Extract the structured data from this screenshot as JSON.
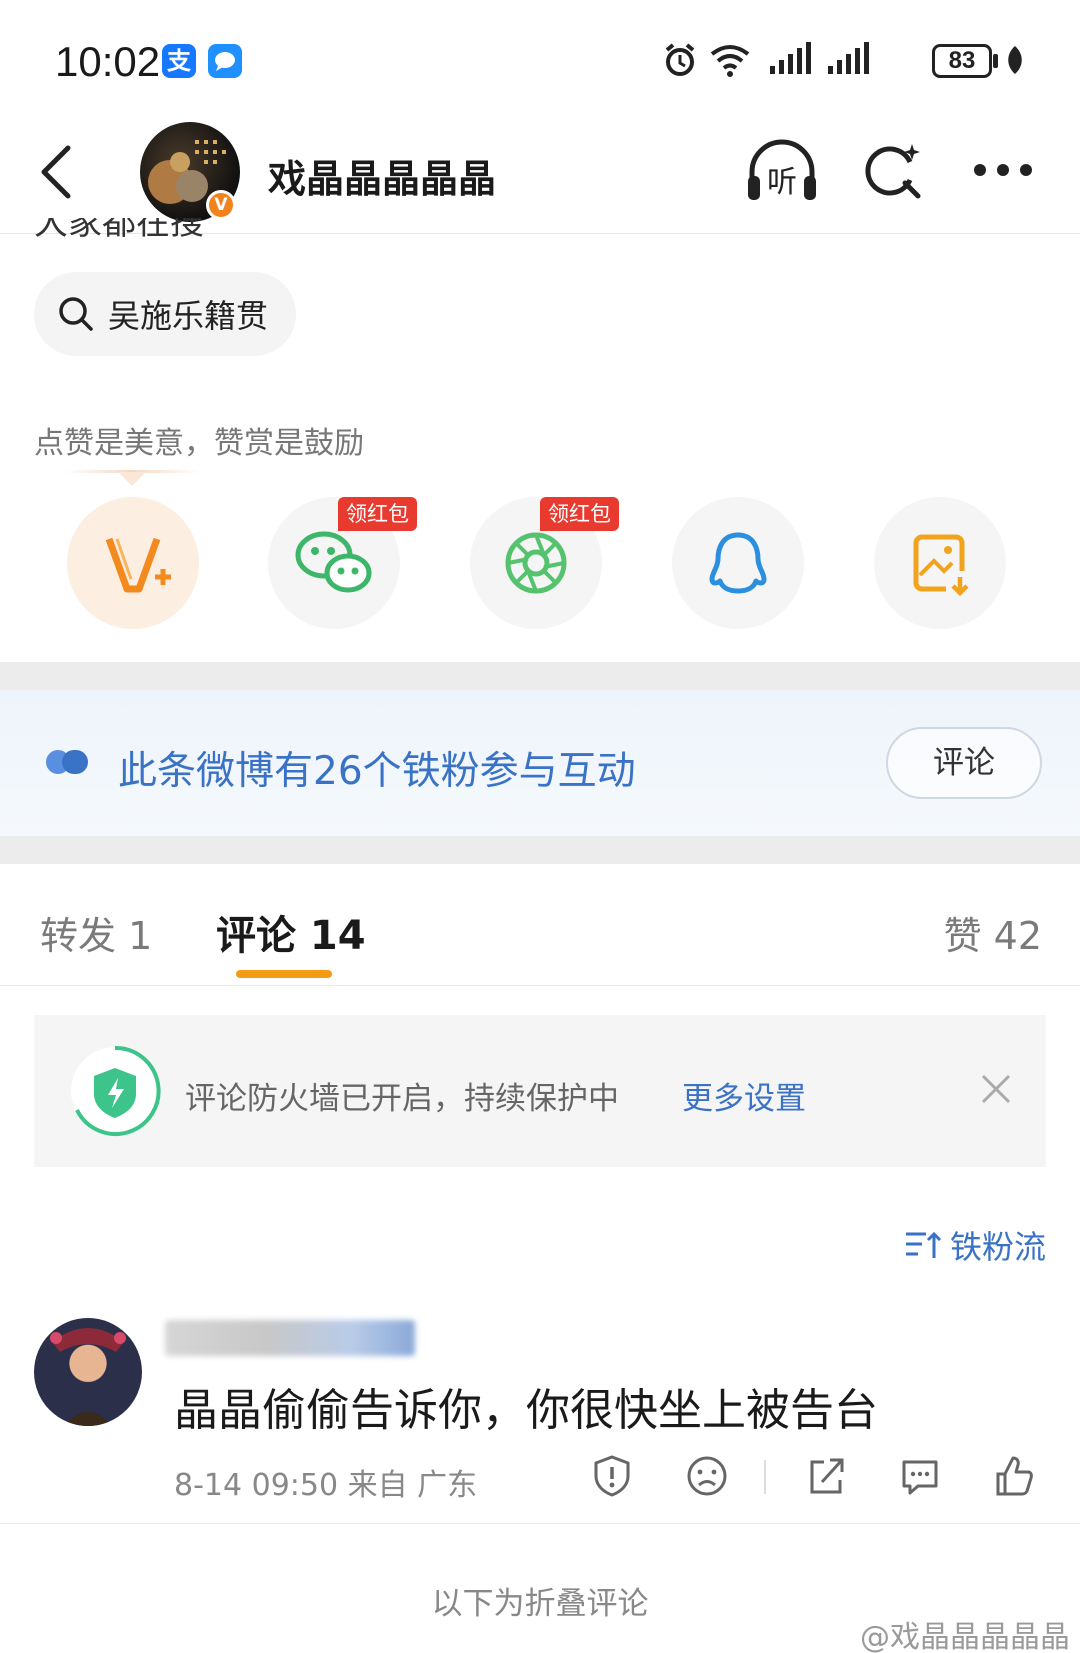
{
  "status_bar": {
    "time": "10:02",
    "battery": "83",
    "icons": [
      "alipay-icon",
      "message-app-icon",
      "alarm-icon",
      "wifi-icon",
      "signal-icon",
      "signal-icon",
      "battery-icon",
      "leaf-icon"
    ]
  },
  "header": {
    "back_icon": "chevron-left-icon",
    "user_name": "戏晶晶晶晶晶",
    "verified_badge": "V",
    "listen_icon": "listen-headphones-icon",
    "listen_label": "听",
    "search_icon": "search-sparkle-icon",
    "more_icon": "more-dots-icon"
  },
  "post": {
    "truncated_text": "大家都在搜",
    "search_chip": "吴施乐籍贯",
    "reward_note": "点赞是美意，赞赏是鼓励"
  },
  "share_row": [
    {
      "name": "v-plus-reward",
      "tag": ""
    },
    {
      "name": "wechat",
      "tag": "领红包"
    },
    {
      "name": "moments",
      "tag": "领红包"
    },
    {
      "name": "qq",
      "tag": ""
    },
    {
      "name": "save-image",
      "tag": ""
    }
  ],
  "fan_banner": {
    "text": "此条微博有26个铁粉参与互动",
    "button": "评论"
  },
  "tabs": {
    "repost": "转发 1",
    "comment": "评论 14",
    "like": "赞 42",
    "active": "comment"
  },
  "firewall": {
    "text": "评论防火墙已开启，持续保护中",
    "link": "更多设置"
  },
  "sort_toggle": "铁粉流",
  "comment": {
    "text": "晶晶偷偷告诉你，你很快坐上被告台",
    "meta": "8-14 09:50  来自 广东",
    "actions": [
      "report-icon",
      "dislike-icon",
      "share-icon",
      "reply-icon",
      "like-icon"
    ]
  },
  "folded_label": "以下为折叠评论",
  "watermark": "@戏晶晶晶晶晶",
  "colors": {
    "accent_orange": "#f49b16",
    "link_blue": "#3a72c5",
    "red_tag": "#e83a2f",
    "wechat_green": "#3db66a",
    "qq_blue": "#2b8fe0"
  }
}
